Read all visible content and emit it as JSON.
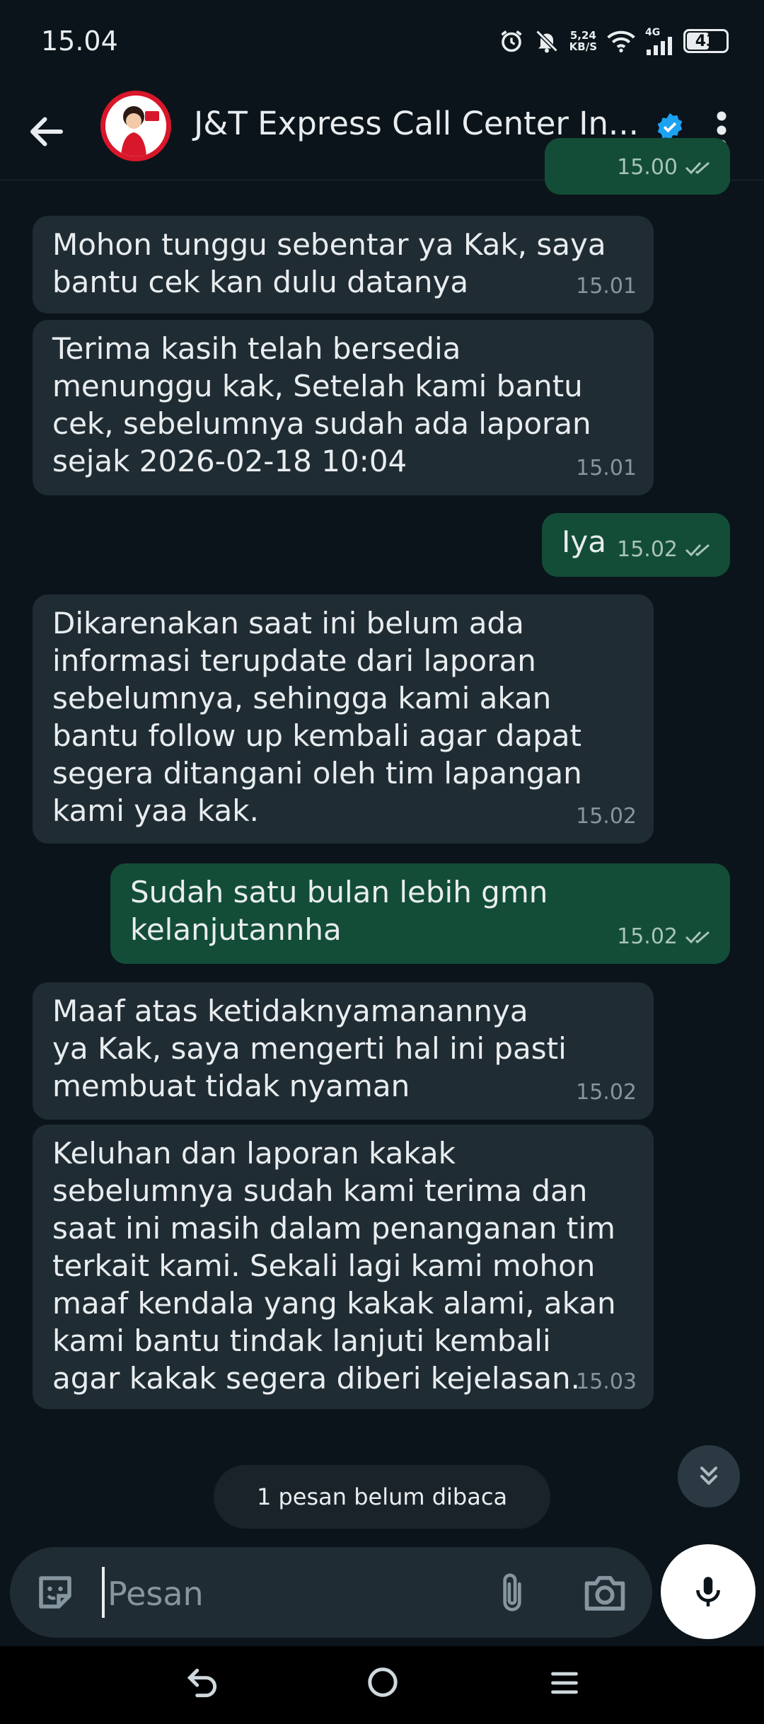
{
  "status_bar": {
    "time": "15.04",
    "net_speed_value": "5,24",
    "net_speed_unit": "KB/S",
    "network_type": "4G",
    "battery": "43",
    "icons": [
      "alarm-icon",
      "mute-bell-icon",
      "wifi-icon",
      "signal-icon",
      "battery-icon"
    ]
  },
  "header": {
    "contact_name": "J&T Express Call Center In...",
    "verified_icon": "verified-badge-icon",
    "back_icon": "arrow-back-icon",
    "menu_icon": "more-vert-icon",
    "accent_color": "#1da1f2",
    "avatar_ring_color": "#d8172a"
  },
  "messages": [
    {
      "direction": "out",
      "text": "",
      "time": "15.00",
      "read": true
    },
    {
      "direction": "in",
      "text": "Mohon tunggu sebentar ya Kak, saya\nbantu cek kan dulu datanya",
      "time": "15.01"
    },
    {
      "direction": "in",
      "text": "Terima kasih telah bersedia\nmenunggu kak, Setelah kami bantu\ncek, sebelumnya sudah ada laporan\nsejak 2026-02-18 10:04",
      "time": "15.01"
    },
    {
      "direction": "out",
      "text": "Iya",
      "time": "15.02",
      "read": true
    },
    {
      "direction": "in",
      "text": "Dikarenakan saat ini belum ada\ninformasi terupdate dari laporan\nsebelumnya, sehingga kami akan\nbantu follow up kembali agar dapat\nsegera ditangani oleh tim lapangan\nkami yaa kak.",
      "time": "15.02"
    },
    {
      "direction": "out",
      "text": "Sudah satu bulan lebih gmn\nkelanjutannha",
      "time": "15.02",
      "read": true
    },
    {
      "direction": "in",
      "text": "Maaf atas ketidaknyamanannya\nya Kak, saya mengerti hal ini pasti\nmembuat tidak nyaman",
      "time": "15.02"
    },
    {
      "direction": "in",
      "text": "Keluhan dan laporan kakak\nsebelumnya sudah kami terima dan\nsaat ini masih dalam penanganan tim\nterkait kami. Sekali lagi kami mohon\nmaaf kendala yang kakak alami, akan\nkami bantu tindak lanjuti kembali\nagar kakak segera diberi kejelasan.",
      "time": "15.03"
    }
  ],
  "unread_banner": "1 pesan belum dibaca",
  "composer": {
    "placeholder": "Pesan",
    "emoji_icon": "sticker-emoji-icon",
    "attach_icon": "paperclip-icon",
    "camera_icon": "camera-icon",
    "mic_icon": "microphone-icon",
    "scroll_icon": "double-chevron-down-icon"
  },
  "colors": {
    "background": "#0b141a",
    "incoming_bubble": "#202c33",
    "outgoing_bubble": "#134d37",
    "meta_text": "#8696a0"
  }
}
